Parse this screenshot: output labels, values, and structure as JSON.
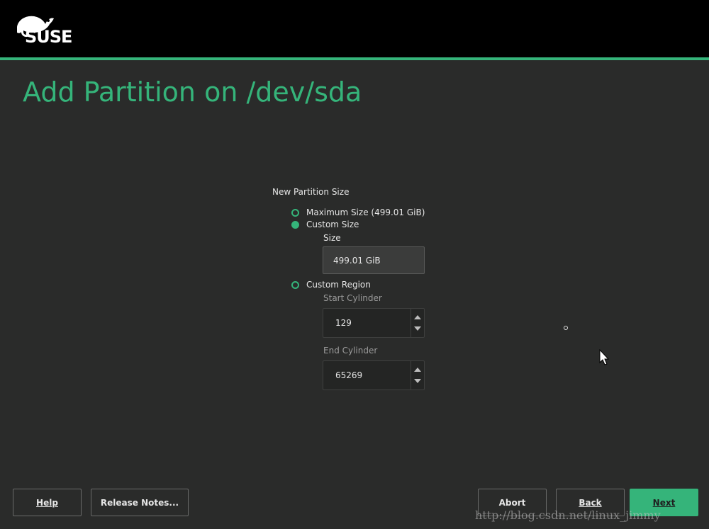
{
  "brand": {
    "logo_text": "SUSE",
    "accent_color": "#35b47a"
  },
  "page": {
    "title": "Add Partition on /dev/sda"
  },
  "partition_size": {
    "section_label": "New Partition Size",
    "options": {
      "maximum": {
        "label": "Maximum Size (499.01 GiB)",
        "selected": false
      },
      "custom_size": {
        "label": "Custom Size",
        "selected": true
      },
      "custom_region": {
        "label": "Custom Region",
        "selected": false
      }
    },
    "size": {
      "label": "Size",
      "value": "499.01 GiB"
    },
    "start_cylinder": {
      "label": "Start Cylinder",
      "value": "129"
    },
    "end_cylinder": {
      "label": "End Cylinder",
      "value": "65269"
    }
  },
  "buttons": {
    "help": "Help",
    "release_notes": "Release Notes...",
    "abort": "Abort",
    "back": "Back",
    "next": "Next"
  },
  "watermark": "http://blog.csdn.net/linux_jimmy"
}
